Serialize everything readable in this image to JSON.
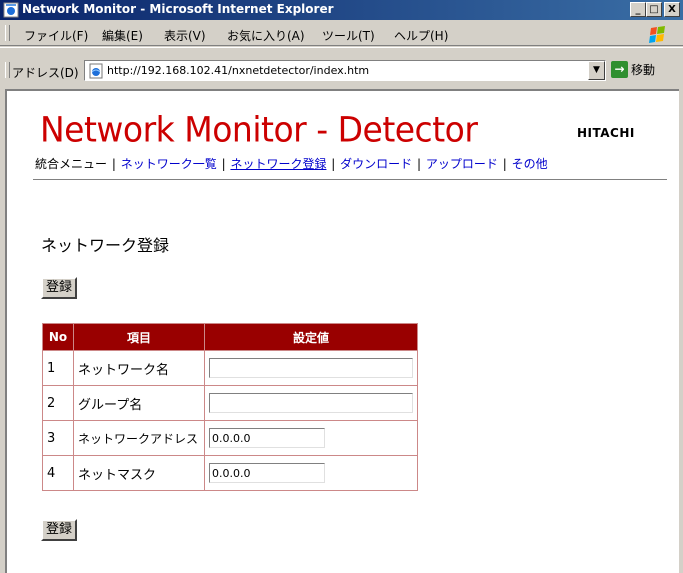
{
  "window": {
    "title": "Network Monitor - Microsoft Internet Explorer",
    "controls": [
      "_",
      "□",
      "X"
    ]
  },
  "menu": [
    "ファイル(F)",
    "編集(E)",
    "表示(V)",
    "お気に入り(A)",
    "ツール(T)",
    "ヘルプ(H)"
  ],
  "address": {
    "label": "アドレス(D)",
    "url": "http://192.168.102.41/nxnetdetector/index.htm",
    "go_label": "移動",
    "go_glyph": "→",
    "dropdown_glyph": "▼"
  },
  "page": {
    "logo": "Network Monitor - Detector",
    "brand": "HITACHI",
    "nav": [
      {
        "label": "統合メニュー",
        "link": false
      },
      {
        "label": "ネットワーク一覧",
        "link": true
      },
      {
        "label": "ネットワーク登録",
        "link": true,
        "current": true
      },
      {
        "label": "ダウンロード",
        "link": true
      },
      {
        "label": "アップロード",
        "link": true
      },
      {
        "label": "その他",
        "link": true
      }
    ],
    "nav_separator": "|",
    "title": "ネットワーク登録",
    "register_label": "登録"
  },
  "form": {
    "headers": [
      "No",
      "項目",
      "設定値"
    ],
    "rows": [
      {
        "no": "1",
        "item": "ネットワーク名",
        "value": ""
      },
      {
        "no": "2",
        "item": "グループ名",
        "value": ""
      },
      {
        "no": "3",
        "item": "ネットワークアドレス",
        "value": "0.0.0.0"
      },
      {
        "no": "4",
        "item": "ネットマスク",
        "value": "0.0.0.0"
      }
    ]
  },
  "colors": {
    "title_bar": "#0a246a",
    "logo": "#cc0000",
    "table_header": "#990000",
    "link": "#0000cc"
  }
}
